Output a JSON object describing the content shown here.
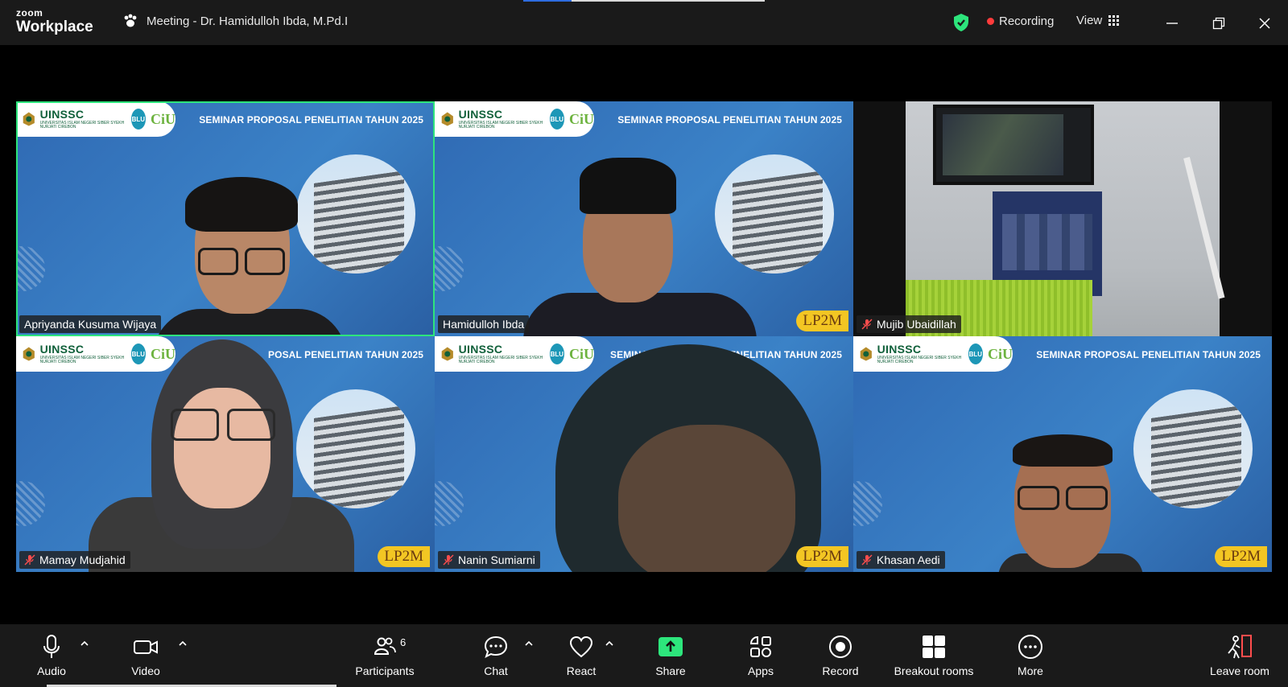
{
  "app": {
    "brand_small": "zoom",
    "brand_large": "Workplace"
  },
  "meeting": {
    "title": "Meeting - Dr. Hamidulloh Ibda, M.Pd.I"
  },
  "status": {
    "recording_label": "Recording",
    "view_label": "View"
  },
  "colors": {
    "active_speaker": "#2de57c",
    "recording_dot": "#ff3b3b",
    "share_green": "#2de57c",
    "slide_blue": "#2f69b3"
  },
  "slide": {
    "org_name": "UINSSC",
    "org_sub": "UNIVERSITAS ISLAM NEGERI SIBER SYEKH NURJATI CIREBON",
    "badge_blu": "BLU",
    "badge_ciu": "CiU",
    "title": "SEMINAR PROPOSAL PENELITIAN TAHUN 2025",
    "title_partial": "POSAL PENELITIAN TAHUN 2025",
    "title_partial_b": "SEMINAR PROPOS",
    "title_partial_c": "PENELITIAN TAHUN 2025",
    "lp2m": "LP2M"
  },
  "participants": [
    {
      "name": "Apriyanda Kusuma Wijaya",
      "muted": false,
      "active": true
    },
    {
      "name": "Hamidulloh Ibda",
      "muted": false,
      "active": false
    },
    {
      "name": "Mujib Ubaidillah",
      "muted": true,
      "active": false
    },
    {
      "name": "Mamay Mudjahid",
      "muted": true,
      "active": false
    },
    {
      "name": "Nanin Sumiarni",
      "muted": true,
      "active": false
    },
    {
      "name": "Khasan Aedi",
      "muted": true,
      "active": false
    }
  ],
  "toolbar": {
    "audio": "Audio",
    "video": "Video",
    "participants": "Participants",
    "participants_count": "6",
    "chat": "Chat",
    "react": "React",
    "share": "Share",
    "apps": "Apps",
    "record": "Record",
    "breakout": "Breakout rooms",
    "more": "More",
    "leave": "Leave room"
  }
}
